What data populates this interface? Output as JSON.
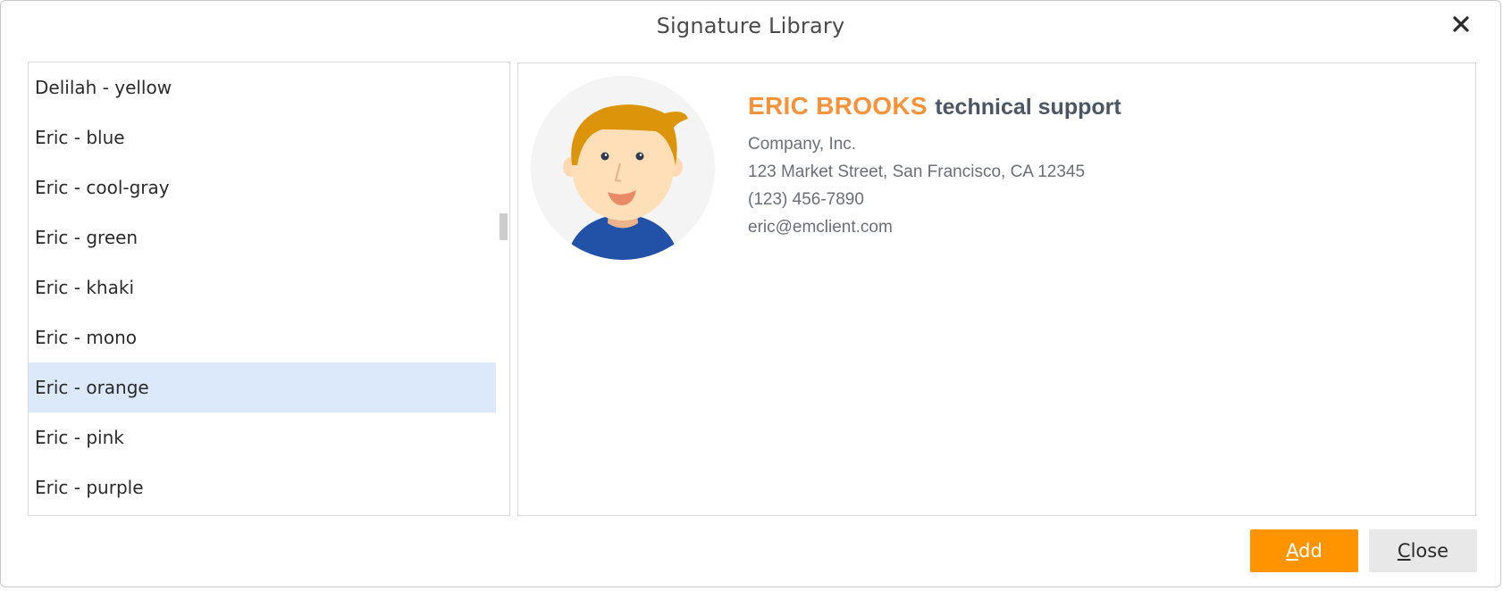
{
  "dialog": {
    "title": "Signature Library"
  },
  "list": {
    "items": [
      {
        "label": "Delilah - yellow"
      },
      {
        "label": "Eric - blue"
      },
      {
        "label": "Eric - cool-gray"
      },
      {
        "label": "Eric - green"
      },
      {
        "label": "Eric - khaki"
      },
      {
        "label": "Eric - mono"
      },
      {
        "label": "Eric - orange",
        "selected": true
      },
      {
        "label": "Eric - pink"
      },
      {
        "label": "Eric - purple"
      }
    ],
    "selected_label": "Eric - orange"
  },
  "preview": {
    "name": "ERIC BROOKS",
    "role": "technical support",
    "company": "Company, Inc.",
    "address": "123 Market Street, San Francisco, CA 12345",
    "phone": "(123) 456-7890",
    "email": "eric@emclient.com",
    "avatar_icon": "person-avatar-icon"
  },
  "buttons": {
    "add_mnemonic": "A",
    "add_rest": "dd",
    "close_mnemonic": "C",
    "close_rest": "lose"
  },
  "icons": {
    "close": "close-icon"
  },
  "colors": {
    "accent": "#ff9400",
    "name_orange": "#f7923a",
    "selection": "#dbe9fa",
    "role_text": "#4b5563"
  }
}
